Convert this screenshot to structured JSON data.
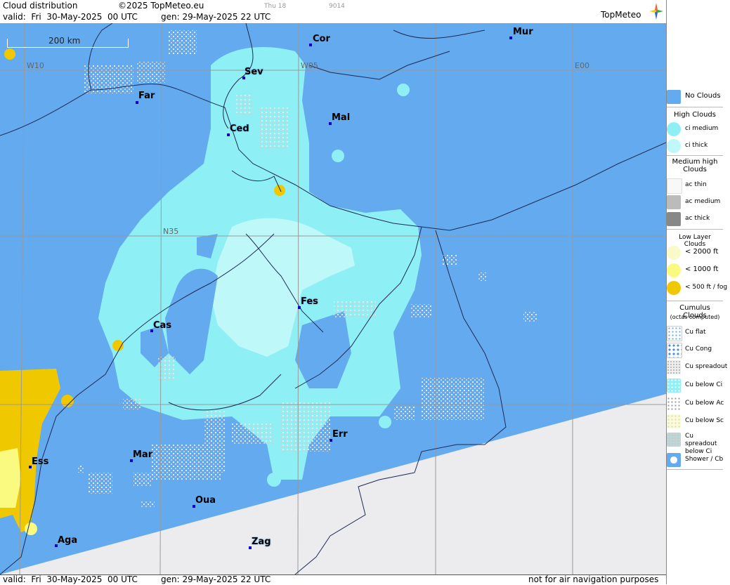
{
  "header": {
    "title": "Cloud distribution",
    "copyright": "©2025 TopMeteo.eu",
    "day_label": "Thu 18",
    "code": "9014",
    "valid": "valid:  Fri  30-May-2025  00 UTC",
    "generated": "gen: 29-May-2025 22 UTC",
    "logo": "TopMeteo"
  },
  "map": {
    "scale_label": "200 km",
    "coordinates": [
      "W10",
      "W05",
      "E00",
      "N35"
    ],
    "cities": [
      "Cor",
      "Mur",
      "Sev",
      "Far",
      "Mal",
      "Ced",
      "Fes",
      "Cas",
      "Err",
      "Mar",
      "Ess",
      "Oua",
      "Aga",
      "Zag"
    ],
    "colors": {
      "no_clouds": "#64aaee",
      "ci_medium": "#8ef0f5",
      "ci_thick": "#bff8f8",
      "low_fog": "#f0c800",
      "no_data": "#ececee"
    }
  },
  "footer": {
    "valid": "valid:  Fri  30-May-2025  00 UTC",
    "generated": "gen: 29-May-2025 22 UTC",
    "disclaimer": "not for air navigation purposes"
  },
  "legend": {
    "no_clouds": "No Clouds",
    "high_clouds": "High Clouds",
    "ci_medium": "ci medium",
    "ci_thick": "ci thick",
    "medium_high_clouds": "Medium high Clouds",
    "ac_thin": "ac thin",
    "ac_medium": "ac medium",
    "ac_thick": "ac thick",
    "low_layer_clouds": "Low Layer Clouds",
    "low_2000": "< 2000 ft",
    "low_1000": "< 1000 ft",
    "low_500": "< 500 ft / fog",
    "cumulus_clouds": "Cumulus Clouds",
    "octas": "(octas computed)",
    "cu_flat": "Cu flat",
    "cu_cong": "Cu Cong",
    "cu_spreadout": "Cu spreadout",
    "cu_below_ci": "Cu below Ci",
    "cu_below_ac": "Cu below Ac",
    "cu_below_sc": "Cu below Sc",
    "cu_spreadout_below_ci": "Cu spreadout below Ci",
    "shower_cb": "Shower / Cb"
  }
}
